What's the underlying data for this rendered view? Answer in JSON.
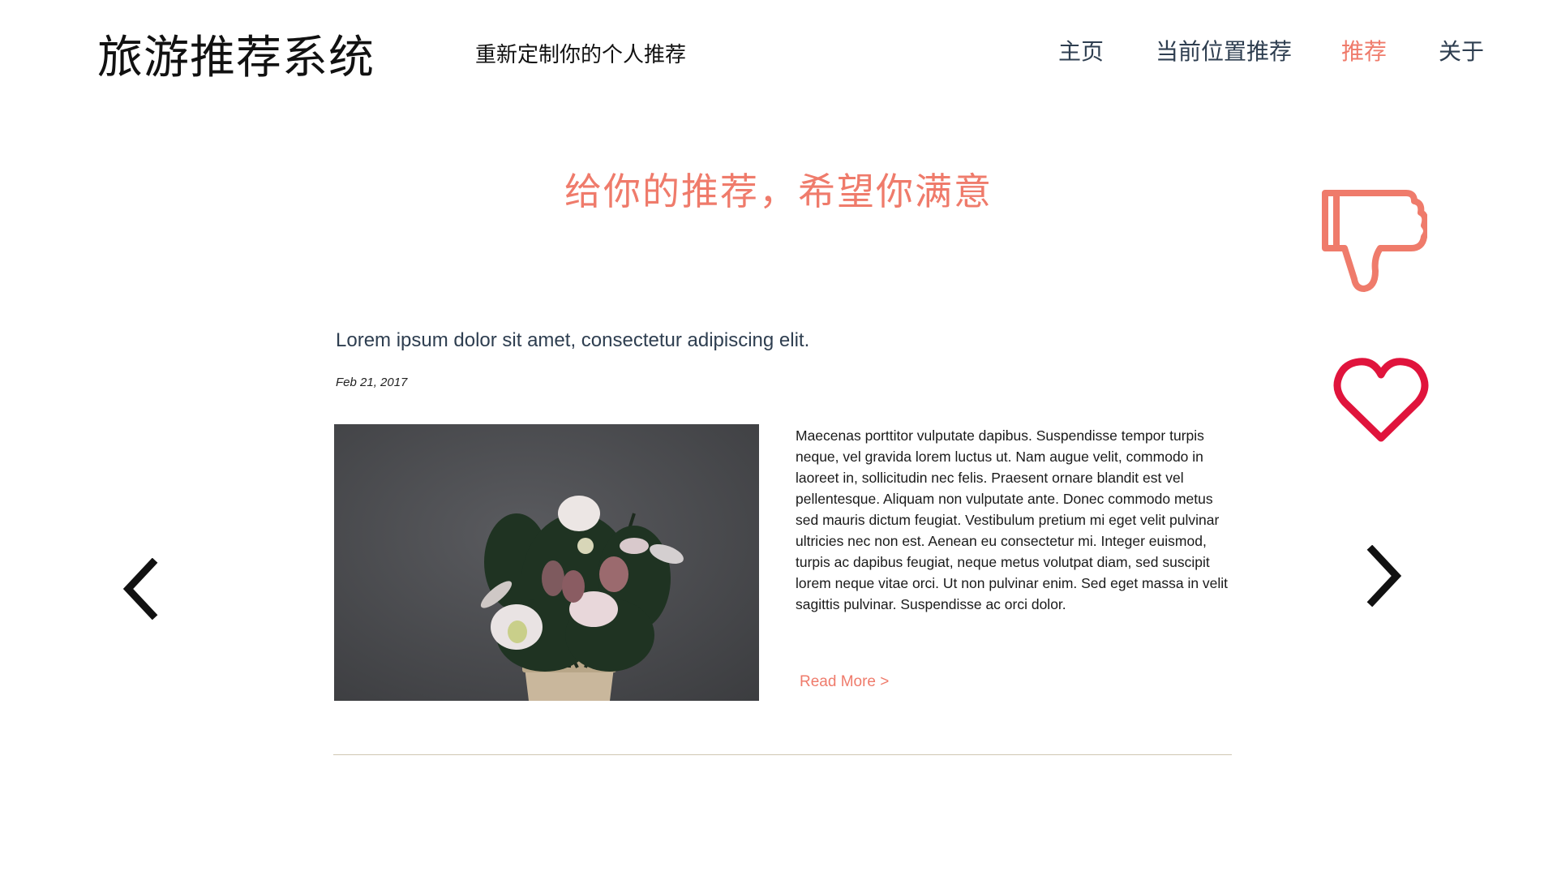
{
  "header": {
    "brand": "旅游推荐系统",
    "tagline": "重新定制你的个人推荐",
    "nav": [
      {
        "label": "主页"
      },
      {
        "label": "当前位置推荐"
      },
      {
        "label": "推荐"
      },
      {
        "label": "关于"
      }
    ]
  },
  "main": {
    "heading": "给你的推荐，希望你满意",
    "article": {
      "title": "Lorem ipsum dolor sit amet, consectetur adipiscing elit.",
      "date": "Feb 21, 2017",
      "body": "Maecenas porttitor vulputate dapibus. Suspendisse tempor turpis neque, vel gravida lorem luctus ut. Nam augue velit, commodo in laoreet in, sollicitudin nec felis. Praesent ornare blandit est vel pellentesque. Aliquam non vulputate ante. Donec commodo metus sed mauris dictum feugiat. Vestibulum pretium mi eget velit pulvinar ultricies nec non est. Aenean eu consectetur mi. Integer euismod, turpis ac dapibus feugiat, neque metus volutpat diam, sed suscipit lorem neque vitae orci. Ut non pulvinar enim. Sed eget massa in velit sagittis pulvinar. Suspendisse ac orci dolor.",
      "read_more": "Read More >"
    }
  },
  "icons": {
    "dislike": "thumbs-down-icon",
    "like": "heart-icon",
    "prev": "chevron-left-icon",
    "next": "chevron-right-icon"
  },
  "colors": {
    "accent": "#ef7b6b",
    "nav_text": "#2e3e50",
    "heart": "#e0143c",
    "divider": "#cfc6b2"
  }
}
